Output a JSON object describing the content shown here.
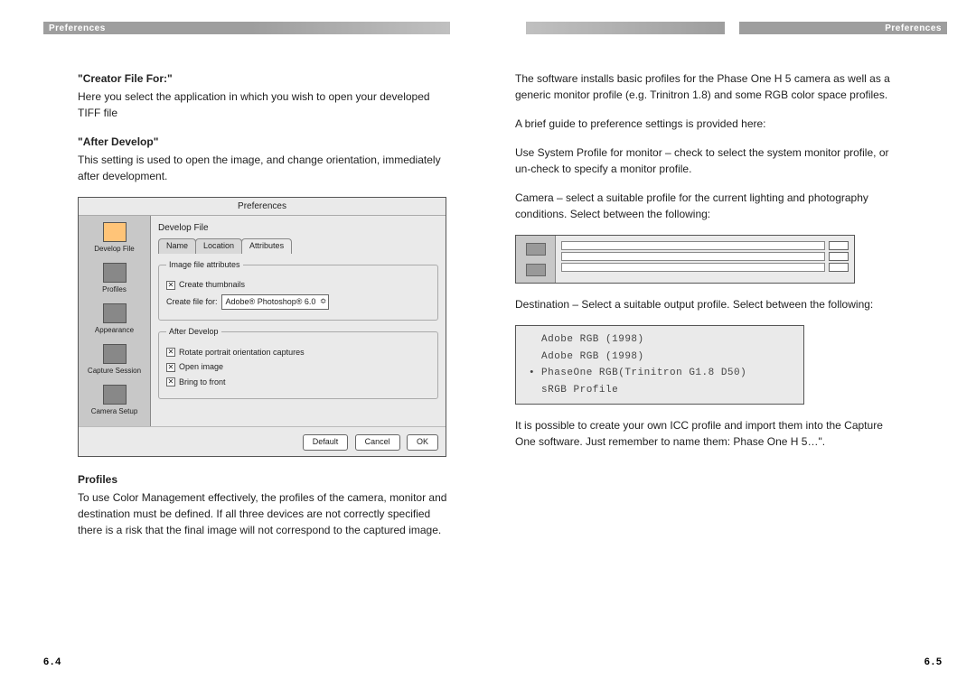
{
  "header": {
    "left": "Preferences",
    "right": "Preferences"
  },
  "left": {
    "h1": "\"Creator File For:\"",
    "p1": "Here you select the application in which you wish to open your developed TIFF file",
    "h2": "\"After Develop\"",
    "p2": "This setting is used to open the image, and change orientation, immediately after development.",
    "h3": "Profiles",
    "p3": "To use Color Management effectively, the profiles of the camera, monitor and destination must be defined. If all three devices are not correctly specified there is a risk that the final image will not correspond to the captured image.",
    "pagenum": "6.4"
  },
  "right": {
    "p1": "The software installs basic profiles for the Phase One H 5 camera as well as a generic monitor profile (e.g. Trinitron 1.8) and some RGB color space profiles.",
    "p2": "A brief guide to preference settings is provided here:",
    "p3": "Use System Profile for monitor – check to select the system monitor profile, or un-check to specify a monitor profile.",
    "p4": "Camera – select a suitable profile for the current lighting and photography conditions. Select between the following:",
    "p5": "Destination – Select a suitable output profile. Select between the following:",
    "p6": "It is possible to create your own ICC profile and import them into the Capture One software. Just remember to name them: Phase One H 5…\".",
    "pagenum": "6.5"
  },
  "dialog": {
    "title": "Preferences",
    "sidebar": [
      "Develop File",
      "Profiles",
      "Appearance",
      "Capture Session",
      "Camera Setup"
    ],
    "maintitle": "Develop File",
    "tabs": [
      "Name",
      "Location",
      "Attributes"
    ],
    "fs1_legend": "Image file attributes",
    "chk1": "Create thumbnails",
    "create_for_label": "Create file for:",
    "create_for_value": "Adobe® Photoshop® 6.0",
    "fs2_legend": "After Develop",
    "chk2": "Rotate portrait orientation captures",
    "chk3": "Open image",
    "chk4": "Bring to front",
    "btn_default": "Default",
    "btn_cancel": "Cancel",
    "btn_ok": "OK"
  },
  "profile_list": {
    "r1": "Adobe RGB (1998)",
    "r2": "Adobe RGB (1998)",
    "r3": "PhaseOne RGB(Trinitron G1.8 D50)",
    "r4": "sRGB Profile"
  }
}
